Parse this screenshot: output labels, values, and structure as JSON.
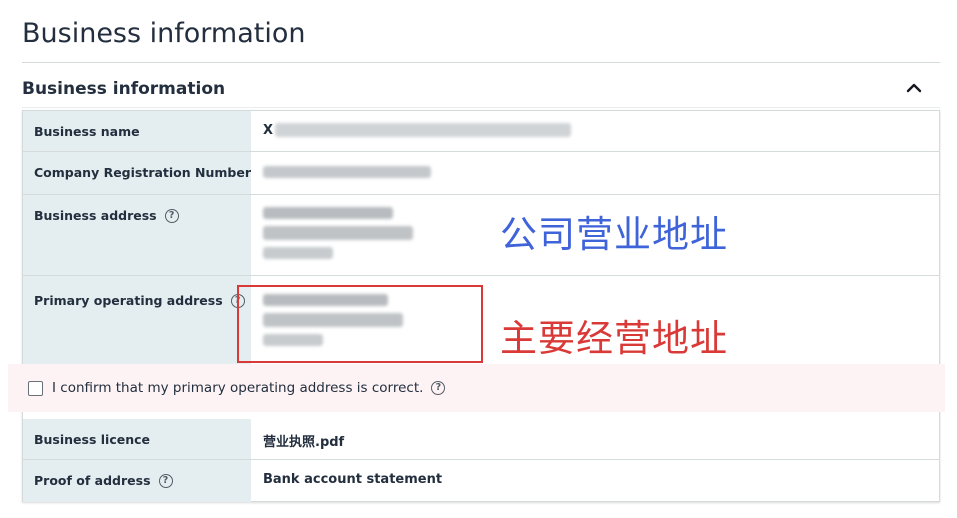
{
  "page": {
    "title": "Business information"
  },
  "section": {
    "title": "Business information",
    "collapse_icon": "chevron-up-icon"
  },
  "fields": {
    "business_name": {
      "label": "Business name",
      "value": "X"
    },
    "company_registration_number": {
      "label": "Company Registration Number",
      "value": ""
    },
    "business_address": {
      "label": "Business address"
    },
    "primary_operating_address": {
      "label": "Primary operating address"
    },
    "business_licence": {
      "label": "Business licence",
      "value": "营业执照.pdf"
    },
    "proof_of_address": {
      "label": "Proof of address",
      "value": "Bank account statement"
    }
  },
  "help_icon": "help-circle-icon",
  "confirm": {
    "text": "I confirm that my primary operating address is correct.",
    "checked": false
  },
  "annotations": {
    "business_address_note": "公司营业地址",
    "primary_address_note": "主要经营地址",
    "blue": "#3f63d8",
    "red": "#d93a37"
  },
  "colors": {
    "label_bg": "#e4eef0",
    "confirm_bg": "#fdf3f4",
    "heading": "#232f3e"
  }
}
